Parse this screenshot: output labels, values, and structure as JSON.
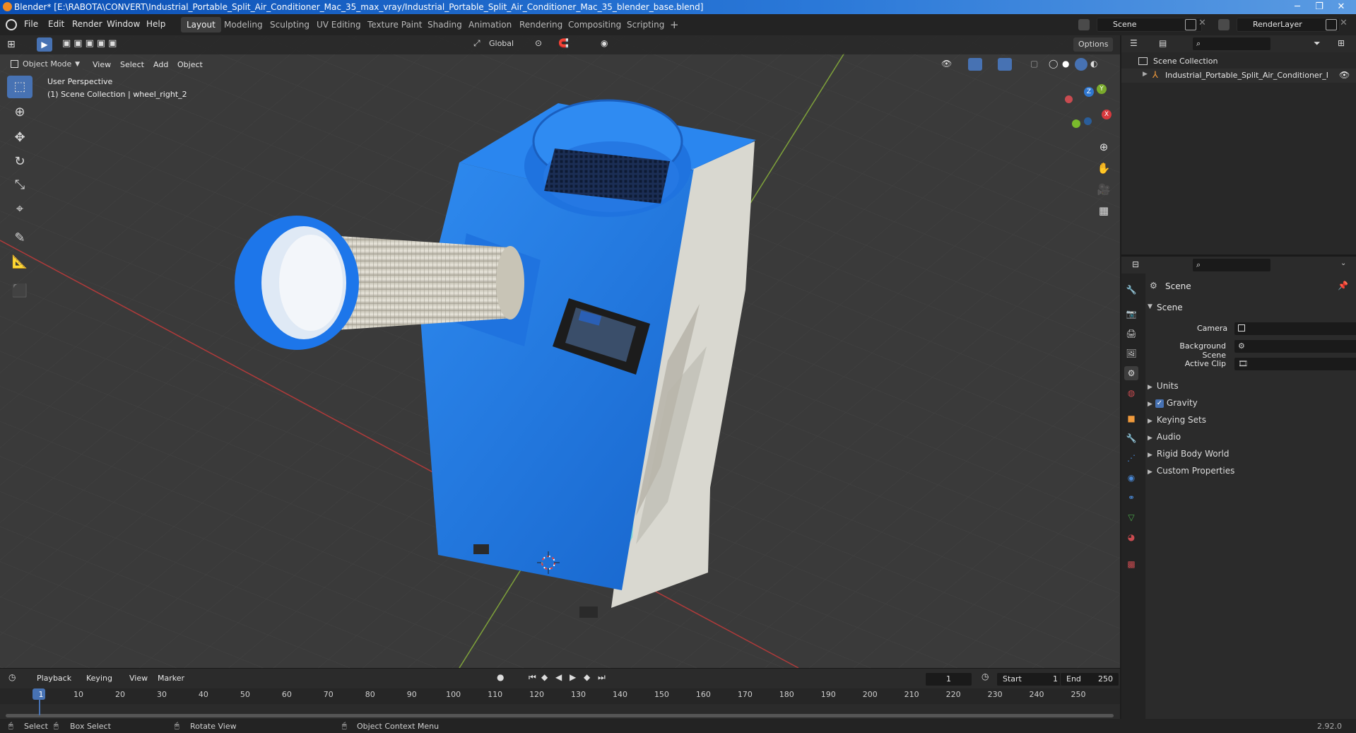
{
  "window": {
    "title": "Blender* [E:\\RABOTA\\CONVERT\\Industrial_Portable_Split_Air_Conditioner_Mac_35_max_vray/Industrial_Portable_Split_Air_Conditioner_Mac_35_blender_base.blend]",
    "minimize": "─",
    "restore": "❐",
    "close": "✕"
  },
  "menu": [
    "File",
    "Edit",
    "Render",
    "Window",
    "Help"
  ],
  "workspaces": [
    "Layout",
    "Modeling",
    "Sculpting",
    "UV Editing",
    "Texture Paint",
    "Shading",
    "Animation",
    "Rendering",
    "Compositing",
    "Scripting"
  ],
  "workspace_add": "+",
  "scene_field": "Scene",
  "renderlayer_field": "RenderLayer",
  "viewport_header": {
    "mode": "Object Mode",
    "menus": [
      "View",
      "Select",
      "Add",
      "Object"
    ],
    "transform": "Global",
    "options": "Options"
  },
  "viewport": {
    "line1": "User Perspective",
    "line2": "(1) Scene Collection | wheel_right_2",
    "axis_x": "X",
    "axis_y": "Y",
    "axis_z": "Z"
  },
  "outliner": {
    "root": "Scene Collection",
    "item": "Industrial_Portable_Split_Air_Conditioner_Ma"
  },
  "properties": {
    "header": "Scene",
    "panel": "Scene",
    "camera_label": "Camera",
    "bg_scene_label": "Background Scene",
    "active_clip_label": "Active Clip",
    "sections": [
      "Units",
      "Gravity",
      "Keying Sets",
      "Audio",
      "Rigid Body World",
      "Custom Properties"
    ]
  },
  "timeline": {
    "menus": [
      "Playback",
      "Keying",
      "View",
      "Marker"
    ],
    "current_frame": "1",
    "start_label": "Start",
    "start_value": "1",
    "end_label": "End",
    "end_value": "250",
    "ticks": [
      "1",
      "10",
      "20",
      "30",
      "40",
      "50",
      "60",
      "70",
      "80",
      "90",
      "100",
      "110",
      "120",
      "130",
      "140",
      "150",
      "160",
      "170",
      "180",
      "190",
      "200",
      "210",
      "220",
      "230",
      "240",
      "250"
    ]
  },
  "status": {
    "select": "Select",
    "box_select": "Box Select",
    "rotate_view": "Rotate View",
    "context_menu": "Object Context Menu",
    "version": "2.92.0"
  },
  "colors": {
    "accent": "#4772b3",
    "unit_blue": "#1f77e8",
    "panel_gray": "#d8d8d2"
  }
}
